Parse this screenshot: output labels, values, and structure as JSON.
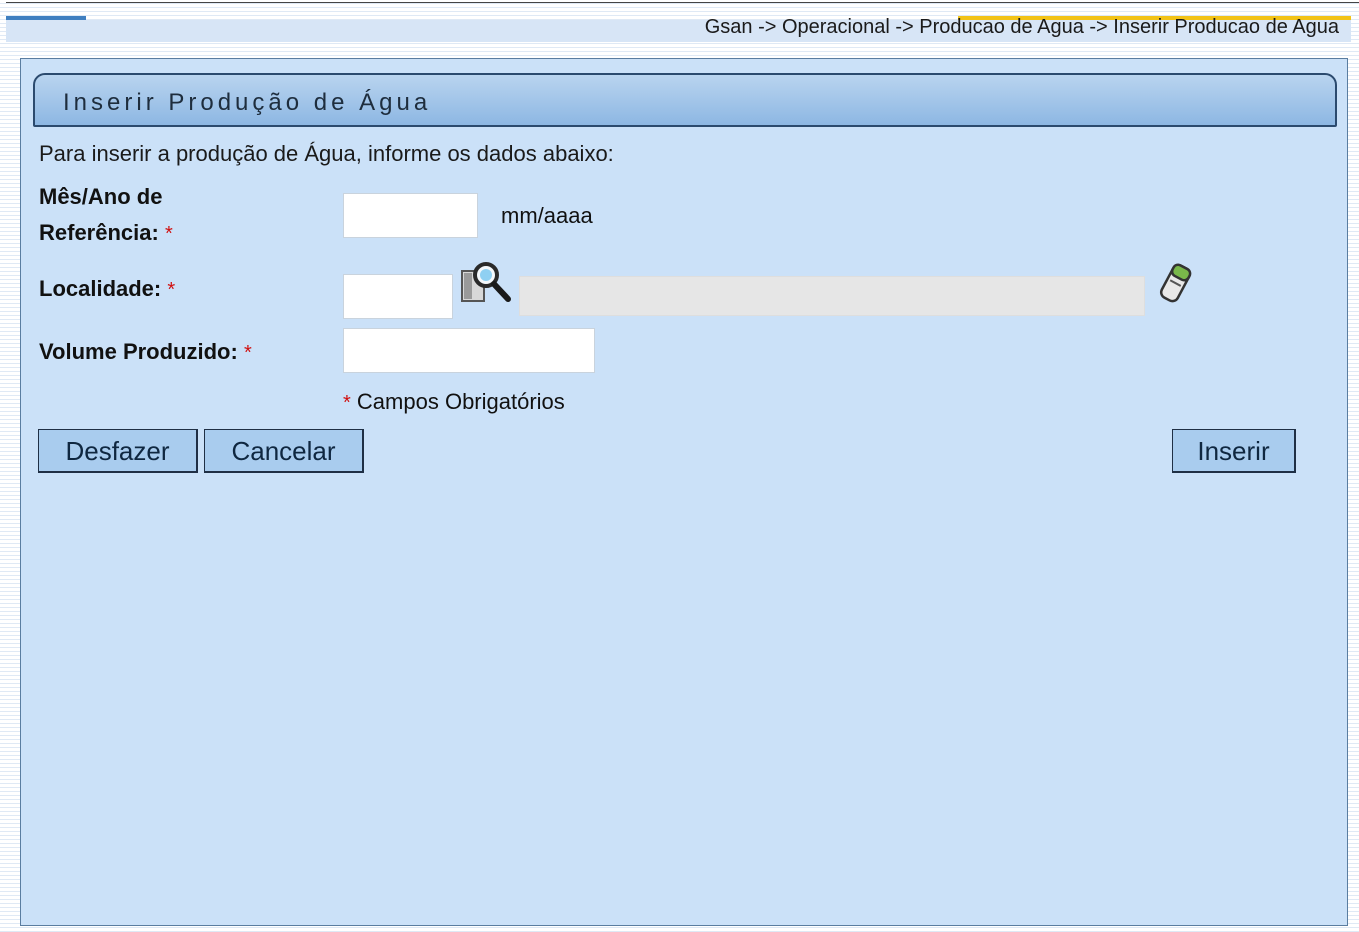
{
  "header": {
    "breadcrumb": "Gsan -> Operacional -> Producao de Agua -> Inserir Producao de Agua"
  },
  "form": {
    "title": "Inserir Produção de Água",
    "intro": "Para inserir a produção de Água, informe os dados abaixo:",
    "required_marker": "*",
    "fields": {
      "mes_ano": {
        "label_line1": "Mês/Ano de",
        "label_line2": "Referência:",
        "value": "",
        "hint": "mm/aaaa"
      },
      "localidade": {
        "label": "Localidade:",
        "code_value": "",
        "description_value": ""
      },
      "volume": {
        "label": "Volume Produzido:",
        "value": ""
      }
    },
    "required_note": "Campos Obrigatórios"
  },
  "buttons": {
    "undo": "Desfazer",
    "cancel": "Cancelar",
    "insert": "Inserir"
  },
  "icons": {
    "search": "search-icon",
    "eraser": "eraser-icon"
  },
  "colors": {
    "panel_bg": "#cbe1f8",
    "title_bar": "#8db7e3",
    "button_bg": "#a9ccee",
    "required": "#d01010",
    "breadcrumb_accent": "#f2c318"
  }
}
